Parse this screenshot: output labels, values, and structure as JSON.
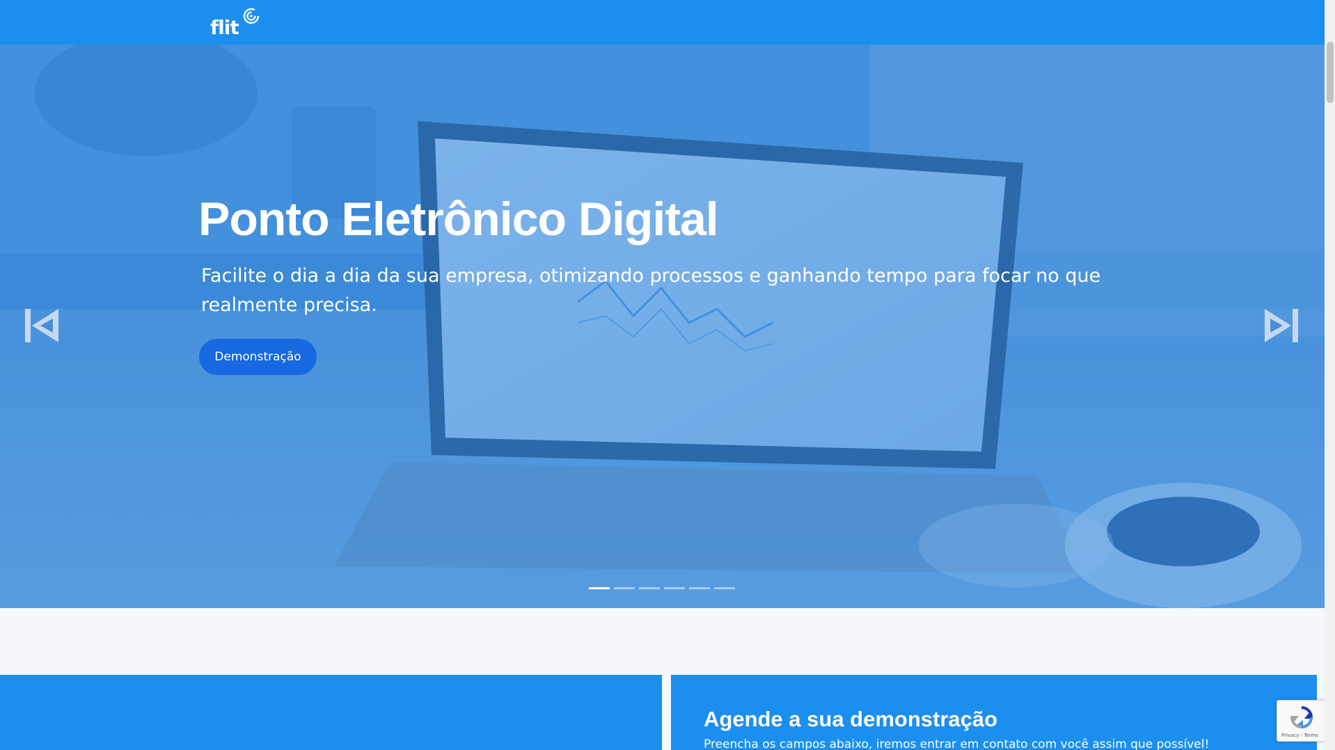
{
  "brand": {
    "name": "flit",
    "logo_icon": "swirl-icon"
  },
  "hero": {
    "title": "Ponto Eletrônico Digital",
    "subtitle": "Facilite o dia a dia da sua empresa, otimizando processos e ganhando tempo para focar no que realmente precisa.",
    "cta_label": "Demonstração",
    "prev_icon": "skip-previous-icon",
    "next_icon": "skip-next-icon",
    "slides_count": 6,
    "active_slide": 1
  },
  "demo_form": {
    "title": "Agende a sua demonstração",
    "subtitle": "Preencha os campos abaixo, iremos entrar em contato com você assim que possível!"
  },
  "recaptcha": {
    "privacy": "Privacy",
    "separator": " - ",
    "terms": "Terms"
  },
  "colors": {
    "primary": "#1a8ff0",
    "cta": "#1669e0",
    "hero_overlay": "#217edc"
  }
}
